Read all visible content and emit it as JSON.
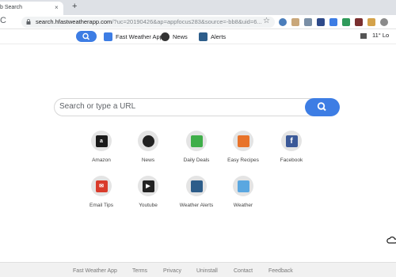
{
  "browser": {
    "tab_title": "b Search",
    "tab_close": "×",
    "new_tab": "+",
    "url_main": "search.hfastweatherapp.com",
    "url_rest": "/?uc=20190426&ap=appfocus283&source=-bb8&uid=6...",
    "reload": "C"
  },
  "toolbar": {
    "items": [
      {
        "label": "Fast Weather App"
      },
      {
        "label": "News"
      },
      {
        "label": "Alerts"
      }
    ],
    "weather": "11° Lo"
  },
  "search": {
    "placeholder": "Search or type a URL"
  },
  "tiles": [
    {
      "label": "Amazon",
      "icon": "amazon-icon",
      "color": "#1a1a1a",
      "glyph": "a"
    },
    {
      "label": "News",
      "icon": "news-icon",
      "color": "#222222",
      "glyph": ""
    },
    {
      "label": "Daily Deals",
      "icon": "daily-deals-icon",
      "color": "#3fae49",
      "glyph": ""
    },
    {
      "label": "Easy Recipes",
      "icon": "easy-recipes-icon",
      "color": "#e8732a",
      "glyph": ""
    },
    {
      "label": "Facebook",
      "icon": "facebook-icon",
      "color": "#3b5998",
      "glyph": "f"
    },
    {
      "label": "Email Tips",
      "icon": "email-tips-icon",
      "color": "#d93b2b",
      "glyph": ""
    },
    {
      "label": "Youtube",
      "icon": "youtube-icon",
      "color": "#222222",
      "glyph": ""
    },
    {
      "label": "Weather Alerts",
      "icon": "weather-alerts-icon",
      "color": "#2d5d8a",
      "glyph": ""
    },
    {
      "label": "Weather",
      "icon": "weather-icon",
      "color": "#5aa7e0",
      "glyph": ""
    }
  ],
  "footer": {
    "links": [
      "Fast Weather App",
      "Terms",
      "Privacy",
      "Uninstall",
      "Contact",
      "Feedback"
    ]
  },
  "colors": {
    "accent": "#3d7de4"
  }
}
